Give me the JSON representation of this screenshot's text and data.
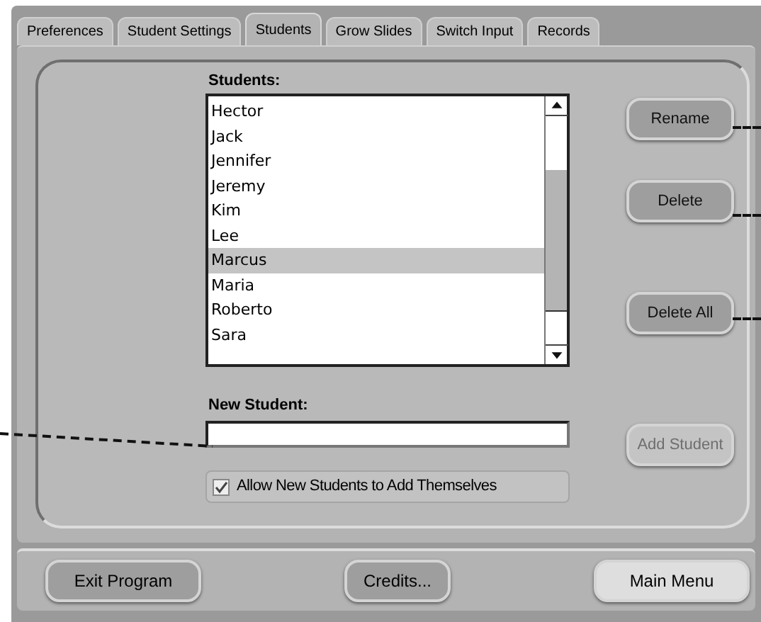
{
  "tabs": [
    {
      "label": "Preferences",
      "selected": false
    },
    {
      "label": "Student Settings",
      "selected": false
    },
    {
      "label": "Students",
      "selected": true
    },
    {
      "label": "Grow Slides",
      "selected": false
    },
    {
      "label": "Switch Input",
      "selected": false
    },
    {
      "label": "Records",
      "selected": false
    }
  ],
  "students_label": "Students:",
  "students": [
    {
      "name": "Hector",
      "selected": false
    },
    {
      "name": "Jack",
      "selected": false
    },
    {
      "name": "Jennifer",
      "selected": false
    },
    {
      "name": "Jeremy",
      "selected": false
    },
    {
      "name": "Kim",
      "selected": false
    },
    {
      "name": "Lee",
      "selected": false
    },
    {
      "name": "Marcus",
      "selected": true
    },
    {
      "name": "Maria",
      "selected": false
    },
    {
      "name": "Roberto",
      "selected": false
    },
    {
      "name": "Sara",
      "selected": false
    }
  ],
  "side_buttons": [
    {
      "label": "Rename",
      "disabled": false
    },
    {
      "label": "Delete",
      "disabled": false
    },
    {
      "label": "Delete All",
      "disabled": false
    },
    {
      "label": "Add Student",
      "disabled": true
    }
  ],
  "new_student_label": "New Student:",
  "allow_checkbox": {
    "label": "Allow New Students to Add Themselves",
    "checked": true
  },
  "bottom_buttons": [
    {
      "label": "Exit Program",
      "selected": false
    },
    {
      "label": "Credits...",
      "selected": false
    },
    {
      "label": "Main Menu",
      "selected": true
    }
  ]
}
